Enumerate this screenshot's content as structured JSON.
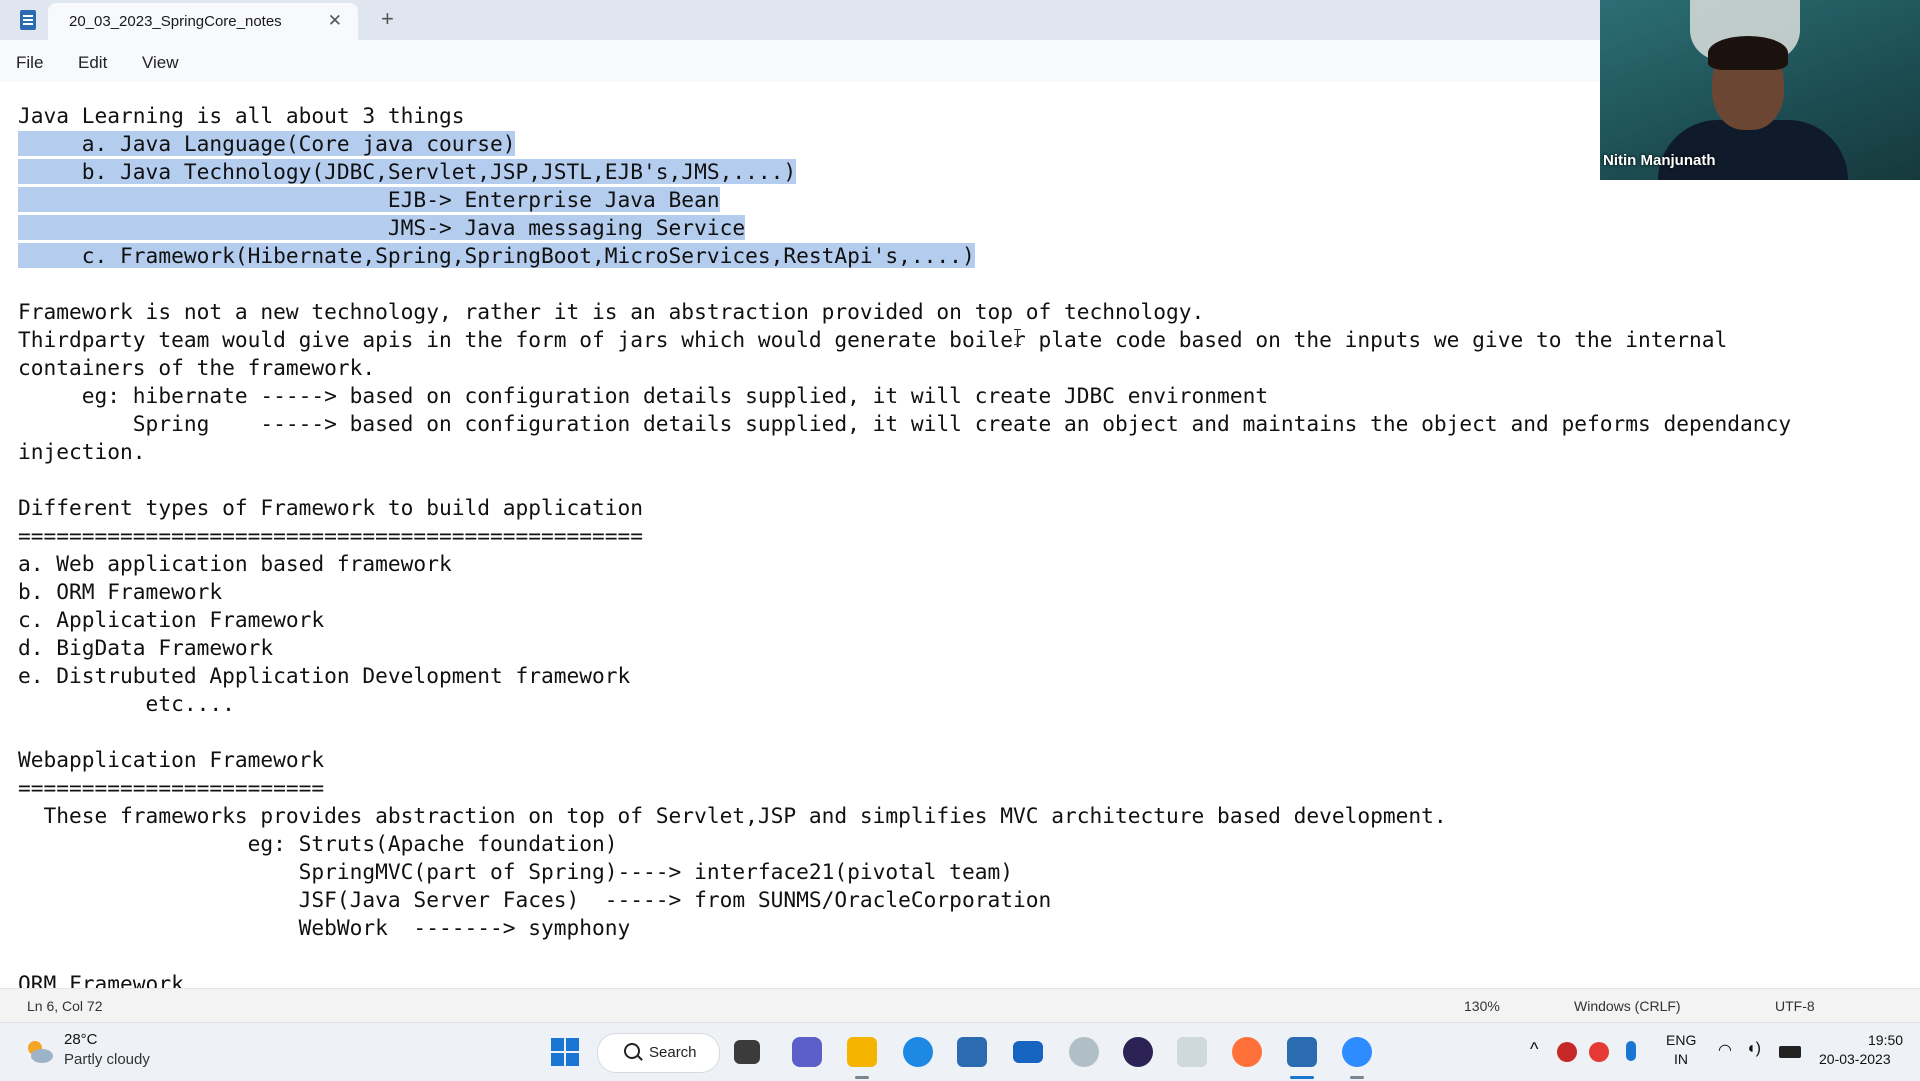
{
  "tab": {
    "title": "20_03_2023_SpringCore_notes",
    "close": "✕",
    "new_tab": "+"
  },
  "menu": [
    "File",
    "Edit",
    "View"
  ],
  "editor_lines": [
    "Java Learning is all about 3 things",
    "     a. Java Language(Core java course)",
    "     b. Java Technology(JDBC,Servlet,JSP,JSTL,EJB's,JMS,....)",
    "                             EJB-> Enterprise Java Bean",
    "                             JMS-> Java messaging Service",
    "     c. Framework(Hibernate,Spring,SpringBoot,MicroServices,RestApi's,....)",
    "",
    "Framework is not a new technology, rather it is an abstraction provided on top of technology.",
    "Thirdparty team would give apis in the form of jars which would generate boiler plate code based on the inputs we give to the internal",
    "containers of the framework.",
    "     eg: hibernate -----> based on configuration details supplied, it will create JDBC environment",
    "         Spring    -----> based on configuration details supplied, it will create an object and maintains the object and peforms dependancy",
    "injection.",
    "",
    "Different types of Framework to build application",
    "=================================================",
    "a. Web application based framework",
    "b. ORM Framework",
    "c. Application Framework",
    "d. BigData Framework",
    "e. Distrubuted Application Development framework",
    "          etc....",
    "",
    "Webapplication Framework",
    "========================",
    "  These frameworks provides abstraction on top of Servlet,JSP and simplifies MVC architecture based development.",
    "                  eg: Struts(Apache foundation)",
    "                      SpringMVC(part of Spring)----> interface21(pivotal team)",
    "                      JSF(Java Server Faces)  -----> from SUNMS/OracleCorporation",
    "                      WebWork  -------> symphony",
    "",
    "ORM Framework"
  ],
  "webcam": {
    "name": "Nitin Manjunath"
  },
  "status": {
    "position": "Ln 6, Col 72",
    "zoom": "130%",
    "line_ending": "Windows (CRLF)",
    "encoding": "UTF-8"
  },
  "taskbar": {
    "weather_temp": "28°C",
    "weather_desc": "Partly cloudy",
    "search_label": "Search",
    "apps": [
      "windows-start-icon",
      "task-view-icon",
      "teams-chat-icon",
      "file-explorer-icon",
      "edge-icon",
      "store-icon",
      "mail-icon",
      "app-icon",
      "eclipse-icon",
      "remote-desktop-icon",
      "firefox-icon",
      "notepad-icon",
      "zoom-icon"
    ],
    "lang": "ENG",
    "region": "IN",
    "time": "19:50",
    "date": "20-03-2023"
  },
  "colors": {
    "selection": "#b4cdee",
    "titlebar": "#dfe6ef",
    "accent": "#1976d2"
  }
}
